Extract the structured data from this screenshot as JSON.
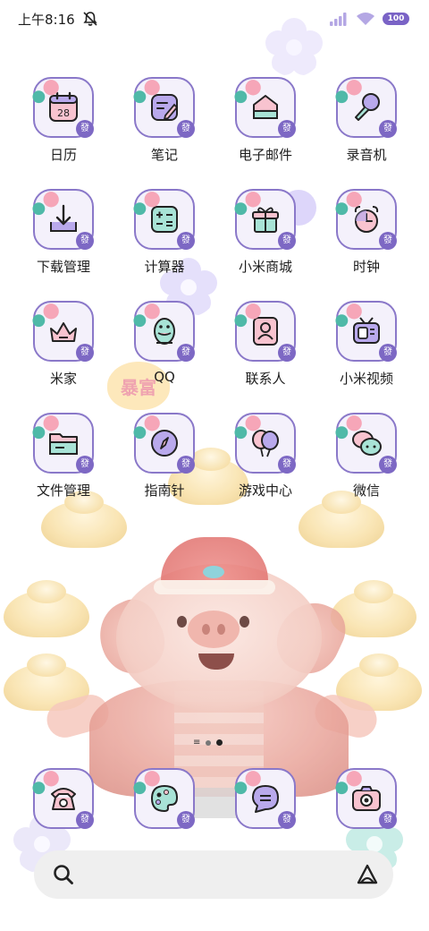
{
  "status_bar": {
    "time": "上午8:16",
    "battery_level": "100",
    "icons": [
      "mute-bell-icon",
      "signal-icon",
      "wifi-icon",
      "battery-icon"
    ]
  },
  "apps": [
    {
      "label": "日历",
      "icon": "calendar-icon",
      "icon_text": "28",
      "badge": "發"
    },
    {
      "label": "笔记",
      "icon": "notes-icon",
      "badge": "發"
    },
    {
      "label": "电子邮件",
      "icon": "mail-icon",
      "badge": "發"
    },
    {
      "label": "录音机",
      "icon": "microphone-icon",
      "badge": "發"
    },
    {
      "label": "下载管理",
      "icon": "download-icon",
      "badge": "發"
    },
    {
      "label": "计算器",
      "icon": "calculator-icon",
      "badge": "發"
    },
    {
      "label": "小米商城",
      "icon": "gift-icon",
      "badge": "發"
    },
    {
      "label": "时钟",
      "icon": "alarm-clock-icon",
      "badge": "發"
    },
    {
      "label": "米家",
      "icon": "crown-icon",
      "badge": "發"
    },
    {
      "label": "QQ",
      "icon": "penguin-icon",
      "badge": "發"
    },
    {
      "label": "联系人",
      "icon": "contacts-icon",
      "badge": "發"
    },
    {
      "label": "小米视频",
      "icon": "tv-icon",
      "badge": "發"
    },
    {
      "label": "文件管理",
      "icon": "folder-icon",
      "badge": "發"
    },
    {
      "label": "指南针",
      "icon": "compass-icon",
      "badge": "發"
    },
    {
      "label": "游戏中心",
      "icon": "balloons-icon",
      "badge": "發"
    },
    {
      "label": "微信",
      "icon": "chat-bubbles-icon",
      "badge": "發"
    }
  ],
  "dock": [
    {
      "icon": "phone-icon",
      "badge": "發"
    },
    {
      "icon": "palette-icon",
      "badge": "發"
    },
    {
      "icon": "message-icon",
      "badge": "發"
    },
    {
      "icon": "camera-icon",
      "badge": "發"
    }
  ],
  "page_indicator": {
    "pages": 2,
    "active": 2
  },
  "search_bar": {
    "left_icon": "search-icon",
    "right_icon": "assistant-icon"
  },
  "wallpaper": {
    "sticker_text": "暴富"
  },
  "colors": {
    "tile_border": "#8a78c9",
    "tile_bg": "#f4f1fb",
    "badge": "#7d68c4",
    "icon_mint": "#a8e3d6",
    "icon_pink": "#f8c3cf",
    "icon_purple": "#b9a9ec"
  }
}
